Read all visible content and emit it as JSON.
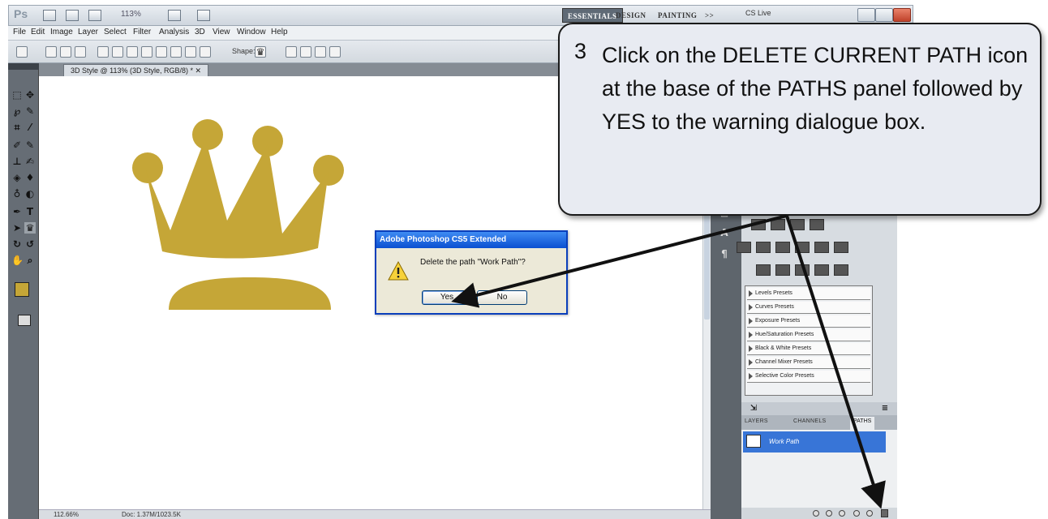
{
  "app": {
    "logo": "Ps",
    "zoom_select": "113%",
    "workspaces": [
      "ESSENTIALS",
      "DESIGN",
      "PAINTING"
    ],
    "more_workspaces": ">>",
    "cslive": "CS Live"
  },
  "menu": [
    "File",
    "Edit",
    "Image",
    "Layer",
    "Select",
    "Filter",
    "Analysis",
    "3D",
    "View",
    "Window",
    "Help"
  ],
  "options_bar": {
    "shape_label": "Shape:"
  },
  "document": {
    "tab_title": "3D Style @ 113% (3D Style, RGB/8) *",
    "zoom_status": "112.66%",
    "doc_size": "Doc: 1.37M/1023.5K"
  },
  "colors": {
    "foreground": "#c5a637",
    "background": "#ffffff",
    "crown": "#c5a637",
    "accent_blue": "#0a4fd1"
  },
  "dialog": {
    "title": "Adobe Photoshop CS5 Extended",
    "message": "Delete the path \"Work Path\"?",
    "yes": "Yes",
    "no": "No",
    "icon": "warning-icon"
  },
  "adjustments": {
    "presets": [
      "Levels Presets",
      "Curves Presets",
      "Exposure Presets",
      "Hue/Saturation Presets",
      "Black & White Presets",
      "Channel Mixer Presets",
      "Selective Color Presets"
    ]
  },
  "layers_panel": {
    "tabs": [
      "LAYERS",
      "CHANNELS",
      "PATHS"
    ],
    "active_tab": "PATHS",
    "paths": [
      "Work Path"
    ]
  },
  "callout": {
    "number": "3",
    "text": "Click on the DELETE CURRENT PATH icon at the base of the PATHS panel followed by YES to the warning dialogue box."
  }
}
